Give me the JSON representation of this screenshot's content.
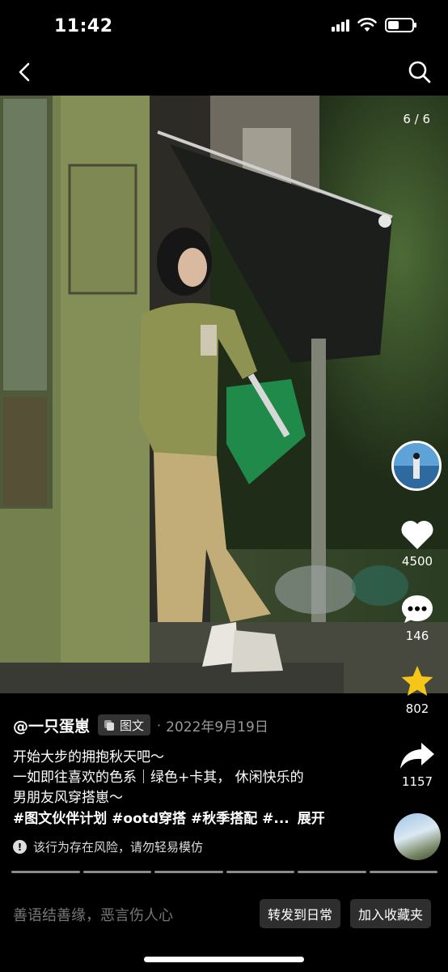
{
  "status_bar": {
    "time": "11:42"
  },
  "nav": {
    "back_icon": "chevron-left-icon",
    "search_icon": "search-icon"
  },
  "photo": {
    "counter": "6 / 6"
  },
  "actions": {
    "likes": "4500",
    "comments": "146",
    "favorites": "802",
    "shares": "1157",
    "colors": {
      "like": "#ffffff",
      "favorite": "#f5c518"
    }
  },
  "caption": {
    "author": "@一只蛋崽",
    "badge": "图文",
    "date": "2022年9月19日",
    "lines": [
      "开始大步的拥抱秋天吧～",
      "一如即往喜欢的色系｜绿色+卡其， 休闲快乐的",
      "男朋友风穿搭崽～"
    ],
    "tags": "#图文伙伴计划 #ootd穿搭 #秋季搭配 #...",
    "expand": "展开",
    "warning": "该行为存在风险，请勿轻易模仿"
  },
  "progress": {
    "total": 6,
    "current": 6
  },
  "bottom_bar": {
    "comment_placeholder": "善语结善缘，恶言伤人心",
    "repost_button": "转发到日常",
    "favorite_button": "加入收藏夹"
  }
}
